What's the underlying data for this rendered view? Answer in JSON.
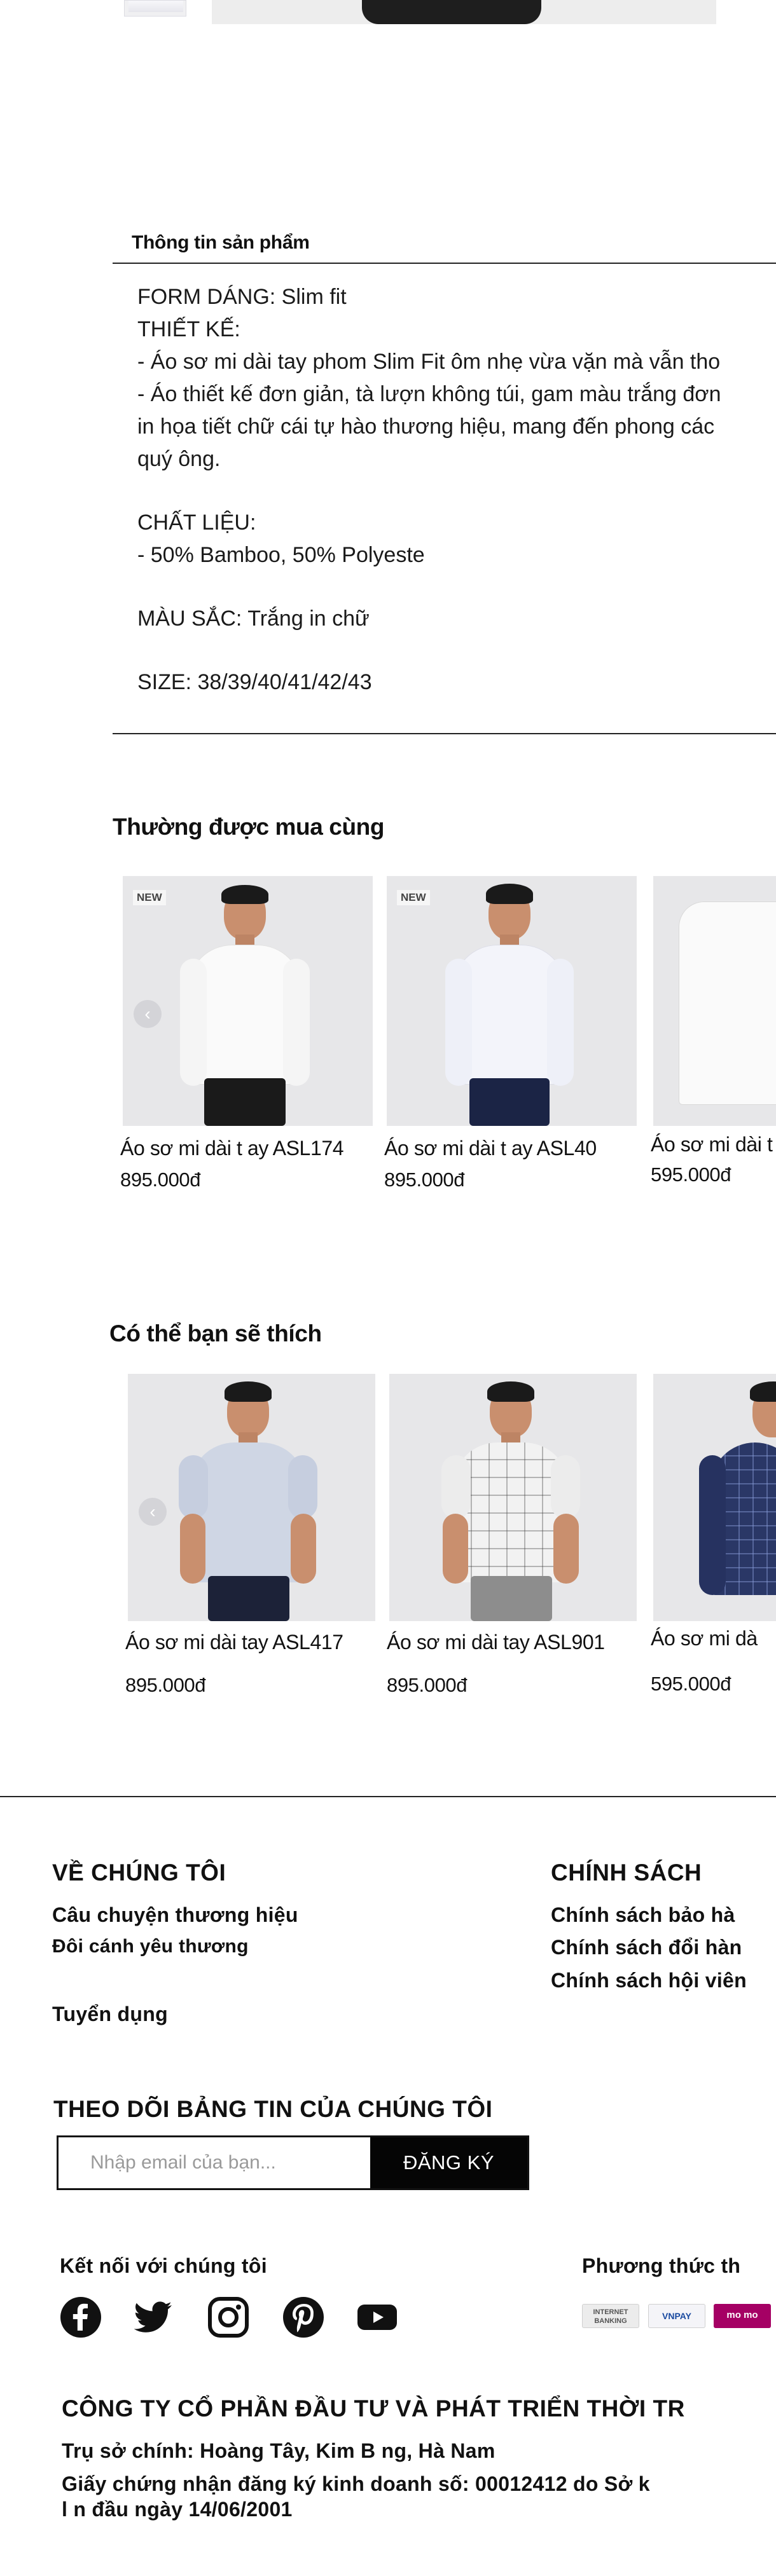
{
  "product_info": {
    "heading": "Thông tin sản phẩm",
    "lines": [
      "FORM DÁNG: Slim fit",
      "THIẾT KẾ:",
      "- Áo sơ mi dài tay phom Slim Fit ôm nhẹ vừa vặn mà vẫn tho",
      "- Áo thiết kế đơn giản, tà lượn không túi, gam màu trắng đơn",
      "in họa tiết chữ cái tự hào thương hiệu, mang đến phong các",
      " quý ông."
    ],
    "material_label": "CHẤT LIỆU:",
    "material_value": "- 50% Bamboo, 50% Polyeste",
    "color": "MÀU SẮC: Trắng in chữ",
    "size": "SIZE: 38/39/40/41/42/43"
  },
  "bought_together": {
    "title": "Thường được mua cùng",
    "prev_icon": "chevron-left-icon",
    "items": [
      {
        "badge": "NEW",
        "name": "Áo sơ mi dài t ay ASL174",
        "price": "895.000đ"
      },
      {
        "badge": "NEW",
        "name": "Áo sơ mi dài t ay ASL40",
        "price": "895.000đ"
      },
      {
        "badge": "",
        "name": "Áo sơ mi dài t",
        "price": "595.000đ"
      }
    ]
  },
  "may_like": {
    "title": "Có thể bạn sẽ thích",
    "prev_icon": "chevron-left-icon",
    "items": [
      {
        "name": "Áo sơ mi dài tay ASL417",
        "price": "895.000đ"
      },
      {
        "name": "Áo sơ mi dài tay ASL901",
        "price": "895.000đ"
      },
      {
        "name": "Áo sơ mi dà",
        "price": "595.000đ"
      }
    ]
  },
  "footer": {
    "about": {
      "title": "VỀ CHÚNG TÔI",
      "links": [
        "Câu chuyện thương hiệu",
        " Đôi cánh yêu thương",
        "Tuyển dụng"
      ]
    },
    "policy": {
      "title": "CHÍNH SÁCH",
      "links": [
        "Chính sách bảo hà",
        "Chính sách  đổi hàn",
        "Chính sách hội viên"
      ]
    },
    "newsletter": {
      "title": "THEO DÕI BẢNG TIN CỦA CHÚNG TÔI",
      "placeholder": "Nhập email của bạn...",
      "button": "ĐĂNG KÝ"
    },
    "connect_title": "Kết nối với chúng tôi",
    "social_icons": [
      "facebook-icon",
      "twitter-icon",
      "instagram-icon",
      "pinterest-icon",
      "youtube-icon"
    ],
    "payment_title": "Phương thức th",
    "payment_methods": [
      "INTERNET BANKING",
      "VNPAY",
      "mo mo"
    ],
    "company": "CÔNG TY CỔ PHẦN ĐẦU TƯ   VÀ PHÁT TRIỂN THỜI TR",
    "address": "Trụ sở  chính: Hoàng Tây, Kim B ng, Hà Nam",
    "license_1": "Giấy chứng nhận   đăng ký kinh doanh số: 00012412 do Sở  k",
    "license_2": "l n   đầu ngày 14/06/2001"
  },
  "colors": {
    "text": "#111111",
    "card_bg": "#e7e7e9",
    "momo": "#a50064",
    "button_bg": "#050505"
  }
}
